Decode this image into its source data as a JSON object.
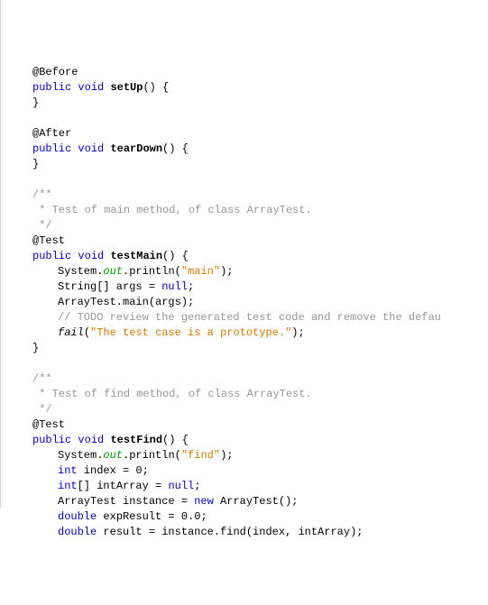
{
  "lines": [
    {
      "indent": 1,
      "spans": [
        {
          "t": "@Before",
          "cls": "ann"
        }
      ]
    },
    {
      "indent": 1,
      "spans": [
        {
          "t": "public",
          "cls": "kw"
        },
        {
          "t": " "
        },
        {
          "t": "void",
          "cls": "kw"
        },
        {
          "t": " "
        },
        {
          "t": "setUp",
          "cls": "method-name"
        },
        {
          "t": "() {"
        }
      ]
    },
    {
      "indent": 1,
      "spans": [
        {
          "t": "}"
        }
      ]
    },
    {
      "indent": 1,
      "spans": [
        {
          "t": ""
        }
      ]
    },
    {
      "indent": 1,
      "spans": [
        {
          "t": "@After",
          "cls": "ann"
        }
      ]
    },
    {
      "indent": 1,
      "spans": [
        {
          "t": "public",
          "cls": "kw"
        },
        {
          "t": " "
        },
        {
          "t": "void",
          "cls": "kw"
        },
        {
          "t": " "
        },
        {
          "t": "tearDown",
          "cls": "method-name"
        },
        {
          "t": "() {"
        }
      ]
    },
    {
      "indent": 1,
      "spans": [
        {
          "t": "}"
        }
      ]
    },
    {
      "indent": 0,
      "spans": [
        {
          "t": ""
        }
      ]
    },
    {
      "indent": 1,
      "spans": [
        {
          "t": "/**",
          "cls": "comment"
        }
      ]
    },
    {
      "indent": 1,
      "spans": [
        {
          "t": " * Test of main method, of class ArrayTest.",
          "cls": "comment"
        }
      ]
    },
    {
      "indent": 1,
      "spans": [
        {
          "t": " */",
          "cls": "comment"
        }
      ]
    },
    {
      "indent": 1,
      "spans": [
        {
          "t": "@Test",
          "cls": "ann"
        }
      ]
    },
    {
      "indent": 1,
      "spans": [
        {
          "t": "public",
          "cls": "kw"
        },
        {
          "t": " "
        },
        {
          "t": "void",
          "cls": "kw"
        },
        {
          "t": " "
        },
        {
          "t": "testMain",
          "cls": "method-name"
        },
        {
          "t": "() {"
        }
      ]
    },
    {
      "indent": 2,
      "spans": [
        {
          "t": "System."
        },
        {
          "t": "out",
          "cls": "static-field"
        },
        {
          "t": ".println("
        },
        {
          "t": "\"main\"",
          "cls": "string"
        },
        {
          "t": ");"
        }
      ]
    },
    {
      "indent": 2,
      "spans": [
        {
          "t": "String[] args = "
        },
        {
          "t": "null",
          "cls": "kw"
        },
        {
          "t": ";"
        }
      ]
    },
    {
      "indent": 2,
      "spans": [
        {
          "t": "ArrayTest.main(args);"
        }
      ]
    },
    {
      "indent": 2,
      "spans": [
        {
          "t": "// TODO review the generated test code and remove the defau",
          "cls": "comment"
        }
      ]
    },
    {
      "indent": 2,
      "spans": [
        {
          "t": "fail",
          "cls": "italic"
        },
        {
          "t": "("
        },
        {
          "t": "\"The test case is a prototype.\"",
          "cls": "string"
        },
        {
          "t": ");"
        }
      ]
    },
    {
      "indent": 1,
      "spans": [
        {
          "t": "}"
        }
      ]
    },
    {
      "indent": 0,
      "spans": [
        {
          "t": ""
        }
      ]
    },
    {
      "indent": 1,
      "spans": [
        {
          "t": "/**",
          "cls": "comment"
        }
      ]
    },
    {
      "indent": 1,
      "spans": [
        {
          "t": " * Test of find method, of class ArrayTest.",
          "cls": "comment"
        }
      ]
    },
    {
      "indent": 1,
      "spans": [
        {
          "t": " */",
          "cls": "comment"
        }
      ]
    },
    {
      "indent": 1,
      "spans": [
        {
          "t": "@Test",
          "cls": "ann"
        }
      ]
    },
    {
      "indent": 1,
      "spans": [
        {
          "t": "public",
          "cls": "kw"
        },
        {
          "t": " "
        },
        {
          "t": "void",
          "cls": "kw"
        },
        {
          "t": " "
        },
        {
          "t": "testFind",
          "cls": "method-name"
        },
        {
          "t": "() {"
        }
      ]
    },
    {
      "indent": 2,
      "spans": [
        {
          "t": "System."
        },
        {
          "t": "out",
          "cls": "static-field"
        },
        {
          "t": ".println("
        },
        {
          "t": "\"find\"",
          "cls": "string"
        },
        {
          "t": ");"
        }
      ]
    },
    {
      "indent": 2,
      "spans": [
        {
          "t": "int",
          "cls": "kw"
        },
        {
          "t": " index = 0;"
        }
      ]
    },
    {
      "indent": 2,
      "spans": [
        {
          "t": "int",
          "cls": "kw"
        },
        {
          "t": "[] intArray = "
        },
        {
          "t": "null",
          "cls": "kw"
        },
        {
          "t": ";"
        }
      ]
    },
    {
      "indent": 2,
      "spans": [
        {
          "t": "ArrayTest instance = "
        },
        {
          "t": "new",
          "cls": "kw"
        },
        {
          "t": " ArrayTest();"
        }
      ]
    },
    {
      "indent": 2,
      "spans": [
        {
          "t": "double",
          "cls": "kw"
        },
        {
          "t": " expResult = 0.0;"
        }
      ]
    },
    {
      "indent": 2,
      "spans": [
        {
          "t": "double",
          "cls": "kw"
        },
        {
          "t": " result = instance.find(index, intArray);"
        }
      ]
    }
  ]
}
